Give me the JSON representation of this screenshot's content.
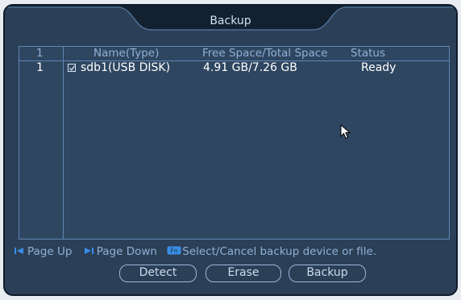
{
  "window": {
    "title": "Backup"
  },
  "table": {
    "headers": {
      "index": "1",
      "name": "Name(Type)",
      "space": "Free Space/Total Space",
      "status": "Status"
    },
    "rows": [
      {
        "index": "1",
        "checked": true,
        "name": "sdb1(USB DISK)",
        "space": "4.91 GB/7.26 GB",
        "status": "Ready"
      }
    ]
  },
  "hints": {
    "page_up": "Page Up",
    "page_down": "Page Down",
    "select": "Select/Cancel backup device or file.",
    "fn_icon": "Fn"
  },
  "buttons": {
    "detect": "Detect",
    "erase": "Erase",
    "backup": "Backup"
  },
  "colors": {
    "background": "#2b3f57",
    "accent": "#5f87b3",
    "header_text": "#8fb0d4",
    "icon_blue": "#3a8ee8"
  }
}
